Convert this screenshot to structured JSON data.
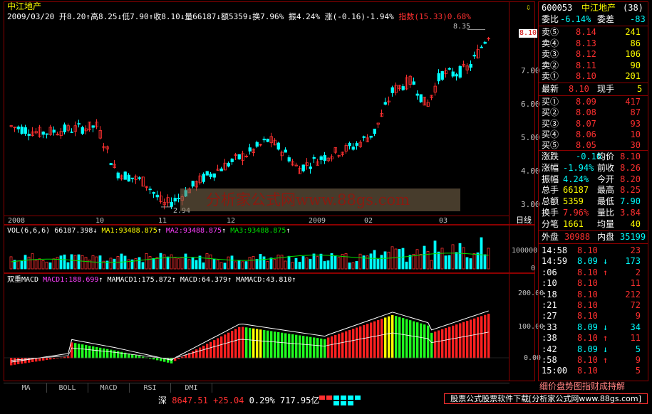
{
  "header": {
    "stock_name": "中江地产",
    "date": "2009/03/20",
    "ohlc_text": "开8.20↑高8.25↓低7.90↑收8.10↓量66187↓额5359↓换7.96% 振4.24%",
    "change_text": "涨(-0.16)-1.94%",
    "index_text": "指数(15.33)0.68%"
  },
  "price_axis": [
    "8.10",
    "7.00",
    "6.00",
    "5.00",
    "4.00",
    "3.00"
  ],
  "price_annotations": {
    "high": "8.35",
    "low": "2.94"
  },
  "date_axis": [
    "2008",
    "10",
    "11",
    "12",
    "2009",
    "02",
    "03"
  ],
  "day_line_label": "日线",
  "volume": {
    "indicator_text": "VOL(6,6,6)",
    "value": "66187.398",
    "ma1": "MA1:93488.875",
    "ma2": "MA2:93488.875",
    "ma3": "MA3:93488.875",
    "axis": [
      "100000",
      "0"
    ]
  },
  "macd": {
    "title": "双重MACD",
    "macd1": "MACD1:188.699",
    "mamacd1": "MAMACD1:175.872",
    "macd": "MACD:64.379",
    "mamacd": "MAMACD:43.810",
    "axis": [
      "200.00",
      "100.00",
      "0.00"
    ]
  },
  "tabs": [
    "MA",
    "BOLL",
    "MACD",
    "RSI",
    "DMI"
  ],
  "status_bar": {
    "index_name": "深",
    "index_value": "8647.51",
    "index_change": "+25.04",
    "index_pct": "0.29%",
    "turnover": "717.95亿",
    "ad_text": "股票公式股票软件下载[分析家公式网www.88gs.com]"
  },
  "watermark": "分析家公式网www.88gs.com",
  "right_panel": {
    "code": "600053",
    "name": "中江地产",
    "count": "(38)",
    "weibi_label": "委比",
    "weibi_value": "-6.14%",
    "weicha_label": "委差",
    "weicha_value": "-83",
    "sell": [
      {
        "label": "卖⑤",
        "price": "8.14",
        "vol": "241"
      },
      {
        "label": "卖④",
        "price": "8.13",
        "vol": "86"
      },
      {
        "label": "卖③",
        "price": "8.12",
        "vol": "106"
      },
      {
        "label": "卖②",
        "price": "8.11",
        "vol": "90"
      },
      {
        "label": "卖①",
        "price": "8.10",
        "vol": "201"
      }
    ],
    "latest_label": "最新",
    "latest_value": "8.10",
    "current_vol_label": "现手",
    "current_vol_value": "5",
    "buy": [
      {
        "label": "买①",
        "price": "8.09",
        "vol": "417"
      },
      {
        "label": "买②",
        "price": "8.08",
        "vol": "87"
      },
      {
        "label": "买③",
        "price": "8.07",
        "vol": "93"
      },
      {
        "label": "买④",
        "price": "8.06",
        "vol": "10"
      },
      {
        "label": "买⑤",
        "price": "8.05",
        "vol": "30"
      }
    ],
    "stats": [
      {
        "l1": "涨跌",
        "v1": "-0.16",
        "l2": "均价",
        "v2": "8.10"
      },
      {
        "l1": "涨幅",
        "v1": "-1.94%",
        "l2": "前收",
        "v2": "8.26"
      },
      {
        "l1": "振幅",
        "v1": "4.24%",
        "l2": "今开",
        "v2": "8.20"
      },
      {
        "l1": "总手",
        "v1": "66187",
        "l2": "最高",
        "v2": "8.25"
      },
      {
        "l1": "总额",
        "v1": "5359",
        "l2": "最低",
        "v2": "7.90"
      },
      {
        "l1": "换手",
        "v1": "7.96%",
        "l2": "量比",
        "v2": "3.84"
      },
      {
        "l1": "分笔",
        "v1": "1661",
        "l2": "均量",
        "v2": "40"
      }
    ],
    "outer_label": "外盘",
    "outer_value": "30988",
    "inner_label": "内盘",
    "inner_value": "35199",
    "ticks": [
      {
        "time": "14:58",
        "price": "8.10",
        "arrow": "",
        "vol": "23"
      },
      {
        "time": "14:59",
        "price": "8.09",
        "arrow": "↓",
        "vol": "173"
      },
      {
        "time": ":06",
        "price": "8.10",
        "arrow": "↑",
        "vol": "2"
      },
      {
        "time": ":10",
        "price": "8.10",
        "arrow": "",
        "vol": "11"
      },
      {
        "time": ":18",
        "price": "8.10",
        "arrow": "",
        "vol": "212"
      },
      {
        "time": ":21",
        "price": "8.10",
        "arrow": "",
        "vol": "72"
      },
      {
        "time": ":27",
        "price": "8.10",
        "arrow": "",
        "vol": "9"
      },
      {
        "time": ":33",
        "price": "8.09",
        "arrow": "↓",
        "vol": "34"
      },
      {
        "time": ":38",
        "price": "8.10",
        "arrow": "↑",
        "vol": "11"
      },
      {
        "time": ":42",
        "price": "8.09",
        "arrow": "↓",
        "vol": "5"
      },
      {
        "time": ":58",
        "price": "8.10",
        "arrow": "↑",
        "vol": "9"
      },
      {
        "time": "15:00",
        "price": "8.10",
        "arrow": "",
        "vol": "5"
      }
    ],
    "bottom_tabs": "细价盘势图指财成持解"
  },
  "colors": {
    "up": "#ff3030",
    "down": "#00ffff",
    "grid": "#8b0000",
    "macd_pos": "#ff2020",
    "macd_neg": "#20ff20",
    "macd_flat": "#ffff00"
  }
}
